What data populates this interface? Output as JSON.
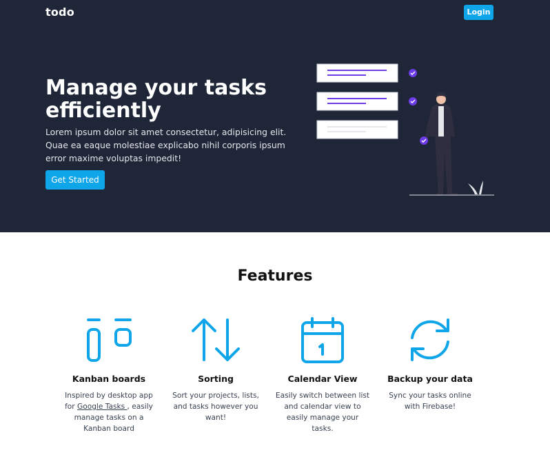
{
  "nav": {
    "logo": "todo",
    "login_label": "Login"
  },
  "hero": {
    "title": "Manage your tasks efficiently",
    "description": "Lorem ipsum dolor sit amet consectetur, adipisicing elit. Quae ea eaque molestiae explicabo nihil corporis ipsum error maxime voluptas impedit!",
    "cta_label": "Get Started"
  },
  "features": {
    "title": "Features",
    "items": [
      {
        "icon": "kanban-icon",
        "name": "Kanban boards",
        "desc_before": "Inspired by desktop app for ",
        "link_text": "Google Tasks ",
        "desc_after": ", easily manage tasks on a Kanban board"
      },
      {
        "icon": "sort-arrows-icon",
        "name": "Sorting",
        "desc": "Sort your projects, lists, and tasks however you want!"
      },
      {
        "icon": "calendar-icon",
        "name": "Calendar View",
        "desc": "Easily switch between list and calendar view to easily manage your tasks."
      },
      {
        "icon": "refresh-icon",
        "name": "Backup your data",
        "desc": "Sync your tasks online with Firebase!"
      }
    ]
  },
  "colors": {
    "hero_bg": "#1f2638",
    "accent": "#0ea5e9",
    "illustration_accent": "#6c3ce9"
  }
}
